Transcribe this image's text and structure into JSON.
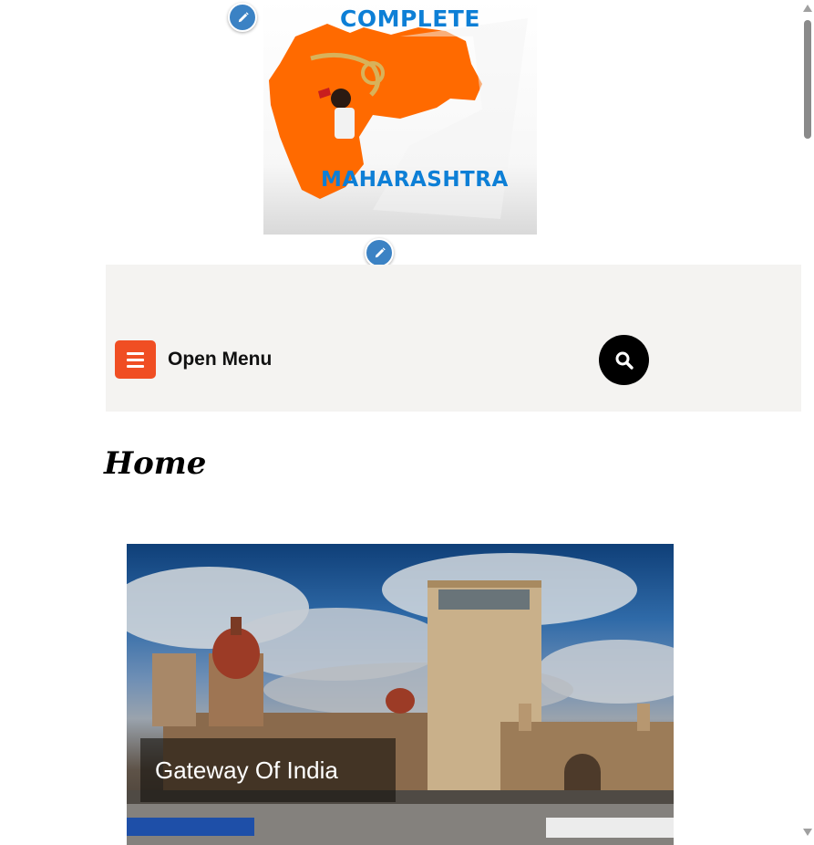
{
  "logo": {
    "line1": "COMPLETE",
    "line2": "MAHARASHTRA",
    "text_color": "#0d7fd6",
    "map_color": "#ff6a00"
  },
  "edit_icons": {
    "icon": "pencil-icon",
    "color": "#3b82c4"
  },
  "nav": {
    "menu_label": "Open Menu",
    "menu_icon": "hamburger-icon",
    "menu_color": "#f04e23",
    "search_icon": "search-icon",
    "background": "#f4f3f1"
  },
  "page": {
    "title": "Home"
  },
  "featured_post": {
    "caption": "Gateway Of India"
  }
}
